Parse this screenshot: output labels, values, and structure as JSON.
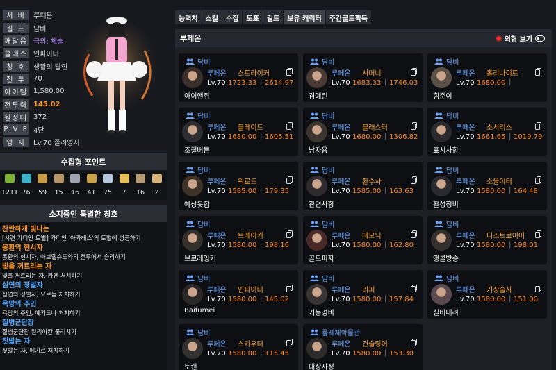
{
  "profile": {
    "rows": [
      {
        "label": "서 버",
        "value": "루페온"
      },
      {
        "label": "길 드",
        "value": "담비"
      },
      {
        "label": "깨달음",
        "value": "극의: 체술"
      },
      {
        "label": "클래스",
        "value": "인파이터"
      },
      {
        "label": "칭 호",
        "value": "생활의 달인"
      },
      {
        "label": "전 투",
        "value": "70"
      },
      {
        "label": "아이템",
        "value": "1,580.00"
      },
      {
        "label": "전투력",
        "value": "145.02"
      },
      {
        "label": "원정대",
        "value": "372"
      },
      {
        "label": "P V P",
        "value": "4단"
      },
      {
        "label": "영 지",
        "value": "Lv.70 졸려영지"
      }
    ]
  },
  "collect": {
    "title": "수집형 포인트",
    "items": [
      {
        "icon": "mokoko-seed-icon",
        "value": "1211",
        "color": "#7fb03a"
      },
      {
        "icon": "island-heart-icon",
        "value": "76",
        "color": "#3fb0c9"
      },
      {
        "icon": "orpheus-star-icon",
        "value": "59",
        "color": "#c79a4a"
      },
      {
        "icon": "giant-heart-icon",
        "value": "15",
        "color": "#b59668"
      },
      {
        "icon": "ignea-token-icon",
        "value": "16",
        "color": "#9ea4b0"
      },
      {
        "icon": "art-masterpiece-icon",
        "value": "41",
        "color": "#c9a24b"
      },
      {
        "icon": "voyage-adventure-icon",
        "value": "75",
        "color": "#b7c7dd"
      },
      {
        "icon": "world-tree-leaf-icon",
        "value": "7",
        "color": "#e8c05a"
      },
      {
        "icon": "sea-bounty-icon",
        "value": "16",
        "color": "#b49b78"
      },
      {
        "icon": "igneas-mark-icon",
        "value": "2",
        "color": "#d6b37a"
      }
    ]
  },
  "titles": {
    "header": "소지중인 특별한 칭호",
    "list": [
      {
        "name": "찬란하게 빛나는",
        "desc": "[시련 가디언 토벌] 가디언 '아카테스'의 토벌에 성공하기",
        "color": "#ff9a2e"
      },
      {
        "name": "몽환의 현시자",
        "desc": "몽환의 현시자, 아브렐슈드와의 전투에서 승리하기",
        "color": "#ff9a2e"
      },
      {
        "name": "빛을 꺼트리는 자",
        "desc": "빛을 꺼트리는 자, 카멘 처치하기",
        "color": "#ff9a2e"
      },
      {
        "name": "심연의 정벌자",
        "desc": "심연의 정벌자, 모르둠 처치하기",
        "color": "#53a8ff"
      },
      {
        "name": "욕망의 주인",
        "desc": "욕망의 주인, 에키드나 처치하기",
        "color": "#53a8ff"
      },
      {
        "name": "질병군단장",
        "desc": "질병군단장 일리아칸 물리치기",
        "color": "#53a8ff"
      },
      {
        "name": "짓밟는 자",
        "desc": "짓밟는 자, 에기르 처치하기",
        "color": "#53a8ff"
      }
    ]
  },
  "tabs": [
    {
      "label": "능력치",
      "active": false
    },
    {
      "label": "스킬",
      "active": false
    },
    {
      "label": "수집",
      "active": false
    },
    {
      "label": "도표",
      "active": false
    },
    {
      "label": "길드",
      "active": false
    },
    {
      "label": "보유 캐릭터",
      "active": true
    },
    {
      "label": "주간골드획득",
      "active": false
    }
  ],
  "main": {
    "server_title": "루페온",
    "outfit_label": "외형 보기"
  },
  "characters": [
    {
      "guild": "담비",
      "server": "루페온",
      "cls": "스트라이커",
      "lv": "Lv.70",
      "ilvl": "1723.33",
      "cp": "2614.97",
      "name": "아이앤쥐"
    },
    {
      "guild": "담비",
      "server": "루페온",
      "cls": "서머너",
      "lv": "Lv.70",
      "ilvl": "1683.33",
      "cp": "1746.03",
      "name": "겸예린"
    },
    {
      "guild": "담비",
      "server": "루페온",
      "cls": "홀리나이트",
      "lv": "Lv.70",
      "ilvl": "1680.00",
      "cp": "",
      "name": "힘준이"
    },
    {
      "guild": "담비",
      "server": "루페온",
      "cls": "블레이드",
      "lv": "Lv.70",
      "ilvl": "1680.00",
      "cp": "1605.51",
      "name": "조절버튼"
    },
    {
      "guild": "담비",
      "server": "루페온",
      "cls": "블래스터",
      "lv": "Lv.70",
      "ilvl": "1680.00",
      "cp": "1306.82",
      "name": "남자용"
    },
    {
      "guild": "담비",
      "server": "루페온",
      "cls": "소서리스",
      "lv": "Lv.70",
      "ilvl": "1661.66",
      "cp": "1019.79",
      "name": "표시사항"
    },
    {
      "guild": "담비",
      "server": "루페온",
      "cls": "워로드",
      "lv": "Lv.70",
      "ilvl": "1585.00",
      "cp": "179.35",
      "name": "예상못함"
    },
    {
      "guild": "담비",
      "server": "루페온",
      "cls": "환수사",
      "lv": "Lv.70",
      "ilvl": "1585.00",
      "cp": "163.63",
      "name": "관련사항"
    },
    {
      "guild": "담비",
      "server": "루페온",
      "cls": "소울이터",
      "lv": "Lv.70",
      "ilvl": "1580.00",
      "cp": "164.48",
      "name": "활성정비"
    },
    {
      "guild": "담비",
      "server": "루페온",
      "cls": "브레이커",
      "lv": "Lv.70",
      "ilvl": "1580.00",
      "cp": "198.16",
      "name": "브르레잉커"
    },
    {
      "guild": "담비",
      "server": "루페온",
      "cls": "데모닉",
      "lv": "Lv.70",
      "ilvl": "1580.00",
      "cp": "162.80",
      "name": "골드피자"
    },
    {
      "guild": "담비",
      "server": "루페온",
      "cls": "디스트로이어",
      "lv": "Lv.70",
      "ilvl": "1580.00",
      "cp": "198.01",
      "name": "앵콜방송"
    },
    {
      "guild": "담비",
      "server": "루페온",
      "cls": "인파이터",
      "lv": "Lv.70",
      "ilvl": "1580.00",
      "cp": "145.02",
      "name": "Baifumei"
    },
    {
      "guild": "담비",
      "server": "루페온",
      "cls": "리퍼",
      "lv": "Lv.70",
      "ilvl": "1580.00",
      "cp": "157.84",
      "name": "기능경비"
    },
    {
      "guild": "담비",
      "server": "루페온",
      "cls": "기상술사",
      "lv": "Lv.70",
      "ilvl": "1580.00",
      "cp": "151.00",
      "name": "실비내려"
    },
    {
      "guild": "담비",
      "server": "루페온",
      "cls": "스카우터",
      "lv": "Lv.70",
      "ilvl": "1580.00",
      "cp": "115.45",
      "name": "토캔"
    },
    {
      "guild": "플레체박물관",
      "server": "루페온",
      "cls": "건슬링어",
      "lv": "Lv.70",
      "ilvl": "1580.00",
      "cp": "153.30",
      "name": "대상사정"
    }
  ]
}
